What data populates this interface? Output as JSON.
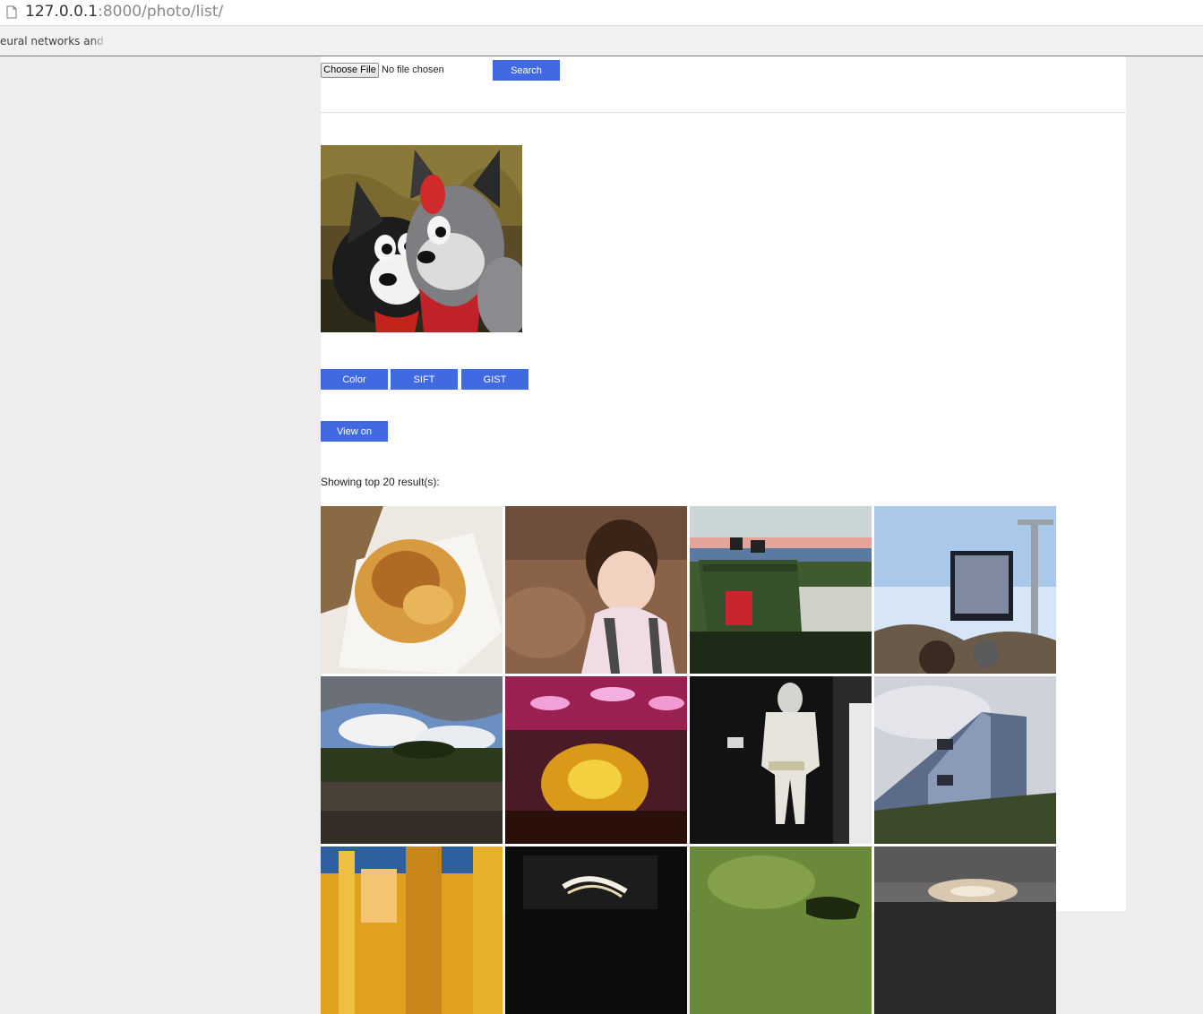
{
  "browser": {
    "url_host": "127.0.0.1",
    "url_rest": ":8000/photo/list/",
    "bookmark": "eural networks and de"
  },
  "search": {
    "choose_file_label": "Choose File",
    "file_status": "No file chosen",
    "search_label": "Search"
  },
  "buttons": {
    "color": "Color",
    "sift": "SIFT",
    "gist": "GIST",
    "map": "View on map"
  },
  "results": {
    "label": "Showing top 20 result(s):"
  },
  "colors": {
    "accent": "#4169e1"
  }
}
